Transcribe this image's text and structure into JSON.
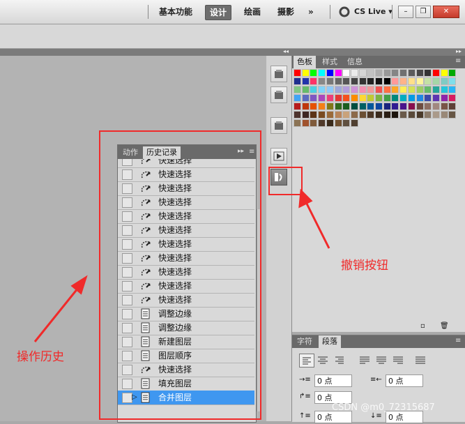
{
  "menubar": {
    "workspaces": [
      "基本功能",
      "设计",
      "绘画",
      "摄影"
    ],
    "active_workspace": "设计",
    "more": "»",
    "cslive": "CS Live",
    "window_buttons": [
      "–",
      "❐",
      "✕"
    ]
  },
  "history_panel": {
    "tabs": [
      "动作",
      "历史记录"
    ],
    "active_tab": "历史记录",
    "menu_icon": "▸▸",
    "items": [
      {
        "label": "快速选择",
        "icon": "quick-select"
      },
      {
        "label": "快速选择",
        "icon": "quick-select"
      },
      {
        "label": "快速选择",
        "icon": "quick-select"
      },
      {
        "label": "快速选择",
        "icon": "quick-select"
      },
      {
        "label": "快速选择",
        "icon": "quick-select"
      },
      {
        "label": "快速选择",
        "icon": "quick-select"
      },
      {
        "label": "快速选择",
        "icon": "quick-select"
      },
      {
        "label": "快速选择",
        "icon": "quick-select"
      },
      {
        "label": "快速选择",
        "icon": "quick-select"
      },
      {
        "label": "快速选择",
        "icon": "quick-select"
      },
      {
        "label": "快速选择",
        "icon": "quick-select"
      },
      {
        "label": "调整边缘",
        "icon": "document"
      },
      {
        "label": "调整边缘",
        "icon": "document"
      },
      {
        "label": "新建图层",
        "icon": "document"
      },
      {
        "label": "图层顺序",
        "icon": "document"
      },
      {
        "label": "快速选择",
        "icon": "quick-select"
      },
      {
        "label": "填充图层",
        "icon": "document"
      },
      {
        "label": "合并图层",
        "icon": "document",
        "selected": true
      }
    ]
  },
  "swatches_panel": {
    "tabs": [
      "色板",
      "样式",
      "信息"
    ],
    "active_tab": "色板",
    "colors": [
      "#ff0000",
      "#ffff00",
      "#00ff00",
      "#00ffff",
      "#0000ff",
      "#ff00ff",
      "#ffffff",
      "#ebebeb",
      "#d6d6d6",
      "#c2c2c2",
      "#adadad",
      "#999999",
      "#858585",
      "#707070",
      "#5c5c5c",
      "#474747",
      "#333333",
      "#ff0000",
      "#ffff00",
      "#00aa00",
      "#1f2f8f",
      "#2233aa",
      "#ff3366",
      "#888888",
      "#777777",
      "#666666",
      "#555555",
      "#444444",
      "#333333",
      "#222222",
      "#111111",
      "#000000",
      "#ff9999",
      "#ffb38a",
      "#ffe08a",
      "#fff59d",
      "#c5e1a5",
      "#a5d6a7",
      "#80cbc4",
      "#80deea",
      "#81c784",
      "#66bb6a",
      "#4dd0e1",
      "#81d4fa",
      "#90caf9",
      "#9fa8da",
      "#b39ddb",
      "#ce93d8",
      "#f48fb1",
      "#ef9a9a",
      "#ef5350",
      "#ff7043",
      "#ffa726",
      "#ffee58",
      "#d4e157",
      "#9ccc65",
      "#66bb6a",
      "#26a69a",
      "#26c6da",
      "#29b6f6",
      "#42a5f5",
      "#5c6bc0",
      "#7e57c2",
      "#ab47bc",
      "#ec407a",
      "#e53935",
      "#f4511e",
      "#fb8c00",
      "#fdd835",
      "#c0ca33",
      "#7cb342",
      "#43a047",
      "#00897b",
      "#00acc1",
      "#039be5",
      "#1e88e5",
      "#3949ab",
      "#5e35b1",
      "#8e24aa",
      "#d81b60",
      "#b71c1c",
      "#bf360c",
      "#e65100",
      "#f57f17",
      "#827717",
      "#33691e",
      "#1b5e20",
      "#004d40",
      "#006064",
      "#01579b",
      "#0d47a1",
      "#1a237e",
      "#311b92",
      "#4a148c",
      "#880e4f",
      "#6d4c41",
      "#8d6e63",
      "#a1887f",
      "#795548",
      "#5d4037",
      "#4e342e",
      "#3e2723",
      "#5c3317",
      "#7a4a20",
      "#9b6a3a",
      "#b8845a",
      "#c9a27a",
      "#8c6a4a",
      "#6b4f33",
      "#4d3826",
      "#3a2a1c",
      "#2a1e14",
      "#1c140d",
      "#6a5a4a",
      "#5a4a3a",
      "#4a3a2a",
      "#8a7a6a",
      "#aa9a8a",
      "#998877",
      "#665544",
      "#8b7355",
      "#a0522d",
      "#7f5a3a",
      "#503a2a",
      "#3a2a1a",
      "#705030",
      "#605040",
      "#504030"
    ]
  },
  "paragraph_panel": {
    "tabs": [
      "字符",
      "段落"
    ],
    "active_tab": "段落",
    "indent_left": "0 点",
    "indent_right": "0 点",
    "indent_first": "0 点",
    "space_before": "0 点",
    "space_after": "0 点"
  },
  "annotations": {
    "history_label": "操作历史",
    "undo_label": "撤销按钮"
  },
  "watermark": "CSDN @m0_72315687"
}
